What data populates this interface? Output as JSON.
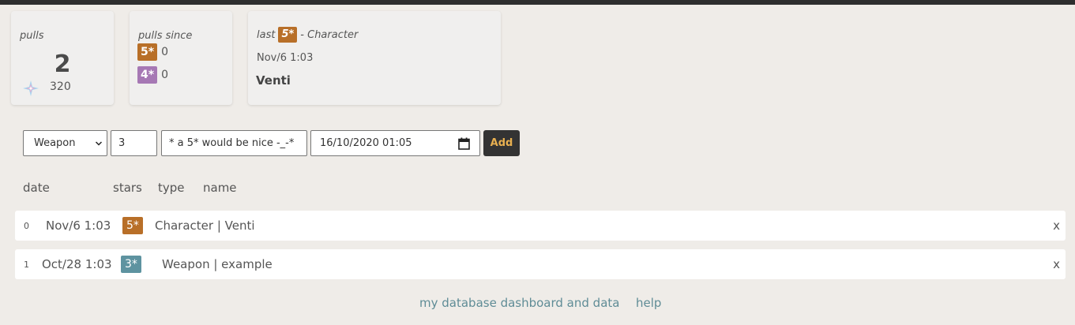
{
  "colors": {
    "five_star": "#b86f28",
    "four_star": "#a678b4",
    "three_star": "#5e93a0",
    "link": "#5f8c96",
    "add_text": "#e8b050"
  },
  "stats": {
    "pulls": {
      "title": "pulls",
      "count": "2",
      "currency_icon": "primogem-icon",
      "currency_value": "320"
    },
    "since": {
      "title": "pulls since",
      "rows": [
        {
          "badge": "5*",
          "value": "0"
        },
        {
          "badge": "4*",
          "value": "0"
        }
      ]
    },
    "last": {
      "prefix": "last",
      "badge": "5*",
      "suffix": "- Character",
      "date": "Nov/6 1:03",
      "name": "Venti"
    }
  },
  "form": {
    "type_value": "Weapon",
    "count_value": "3",
    "note_value": "* a 5* would be nice -_-*",
    "date_value": "16/10/2020 01:05",
    "add_label": "Add"
  },
  "table": {
    "headers": {
      "date": "date",
      "stars": "stars",
      "type": "type",
      "name": "name"
    },
    "rows": [
      {
        "index": "0",
        "date": "Nov/6 1:03",
        "stars": "5*",
        "text": "Character | Venti",
        "delete": "x"
      },
      {
        "index": "1",
        "date": "Oct/28 1:03",
        "stars": "3*",
        "text": "Weapon | example",
        "delete": "x"
      }
    ]
  },
  "footer": {
    "dashboard_link": "my database dashboard and data",
    "help_link": "help"
  }
}
